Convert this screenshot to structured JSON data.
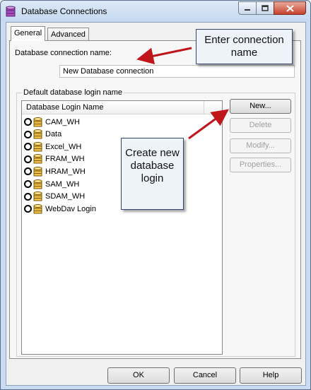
{
  "window": {
    "title": "Database Connections"
  },
  "tabs": [
    {
      "label": "General"
    },
    {
      "label": "Advanced"
    }
  ],
  "connection": {
    "name_label": "Database connection name:",
    "name_value": "New Database connection"
  },
  "login_group": {
    "label": "Default database login name",
    "column_header": "Database Login Name",
    "items": [
      {
        "label": "CAM_WH"
      },
      {
        "label": "Data"
      },
      {
        "label": "Excel_WH"
      },
      {
        "label": "FRAM_WH"
      },
      {
        "label": "HRAM_WH"
      },
      {
        "label": "SAM_WH"
      },
      {
        "label": "SDAM_WH"
      },
      {
        "label": "WebDav Login"
      }
    ]
  },
  "side_buttons": {
    "new": "New...",
    "delete": "Delete",
    "modify": "Modify...",
    "properties": "Properties..."
  },
  "footer_buttons": {
    "ok": "OK",
    "cancel": "Cancel",
    "help": "Help"
  },
  "callouts": {
    "connection_name": "Enter connection name",
    "new_login": "Create new database login"
  },
  "colors": {
    "arrow": "#c0151b",
    "callout_border": "#31466b",
    "titlebar": "#c9dcf2",
    "close_button": "#c7422c"
  },
  "icons": {
    "app": "database-connections-icon",
    "minimize": "minimize-icon",
    "maximize": "maximize-icon",
    "close": "close-icon",
    "item": "database-login-icon"
  }
}
